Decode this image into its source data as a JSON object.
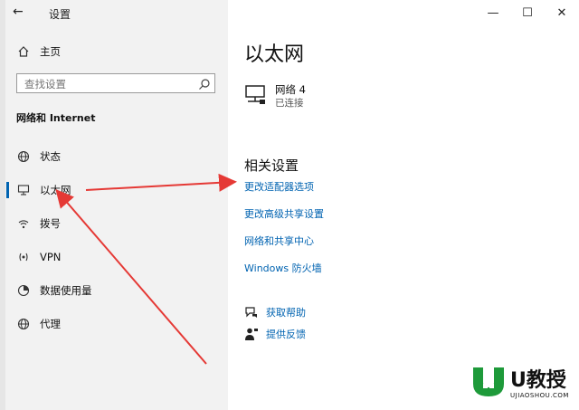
{
  "window": {
    "title": "设置",
    "back_glyph": "←",
    "minimize_glyph": "—",
    "maximize_glyph": "☐",
    "close_glyph": "✕"
  },
  "sidebar": {
    "home_label": "主页",
    "search_placeholder": "查找设置",
    "section_title": "网络和 Internet",
    "items": [
      {
        "label": "状态",
        "icon": "globe-icon"
      },
      {
        "label": "以太网",
        "icon": "monitor-icon",
        "active": true
      },
      {
        "label": "拨号",
        "icon": "dialup-icon"
      },
      {
        "label": "VPN",
        "icon": "vpn-icon"
      },
      {
        "label": "数据使用量",
        "icon": "data-usage-icon"
      },
      {
        "label": "代理",
        "icon": "globe-icon"
      }
    ]
  },
  "main": {
    "title": "以太网",
    "network": {
      "name": "网络 4",
      "status": "已连接",
      "icon": "ethernet-icon"
    },
    "related_title": "相关设置",
    "links": [
      "更改适配器选项",
      "更改高级共享设置",
      "网络和共享中心",
      "Windows 防火墙"
    ],
    "help": [
      {
        "label": "获取帮助",
        "icon": "help-chat-icon"
      },
      {
        "label": "提供反馈",
        "icon": "feedback-icon"
      }
    ]
  },
  "colors": {
    "accent": "#0063b1",
    "arrow": "#e53935",
    "sidebar_bg": "#f2f2f2",
    "watermark_green": "#1e9a3a"
  },
  "watermark": {
    "main": "U教授",
    "sub": "UJIAOSHOU.COM"
  }
}
